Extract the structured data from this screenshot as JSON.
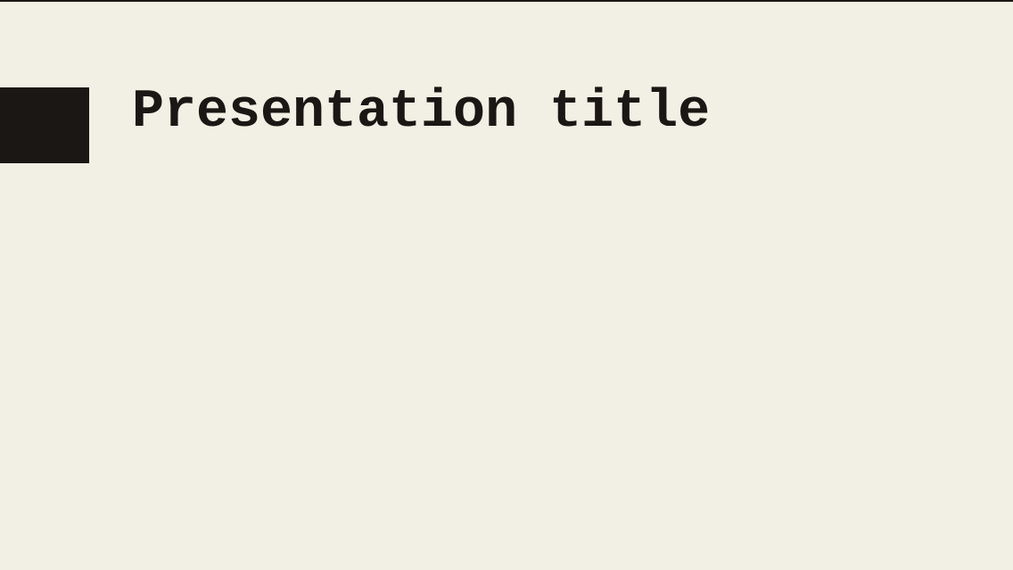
{
  "slide": {
    "title": "Presentation title"
  }
}
